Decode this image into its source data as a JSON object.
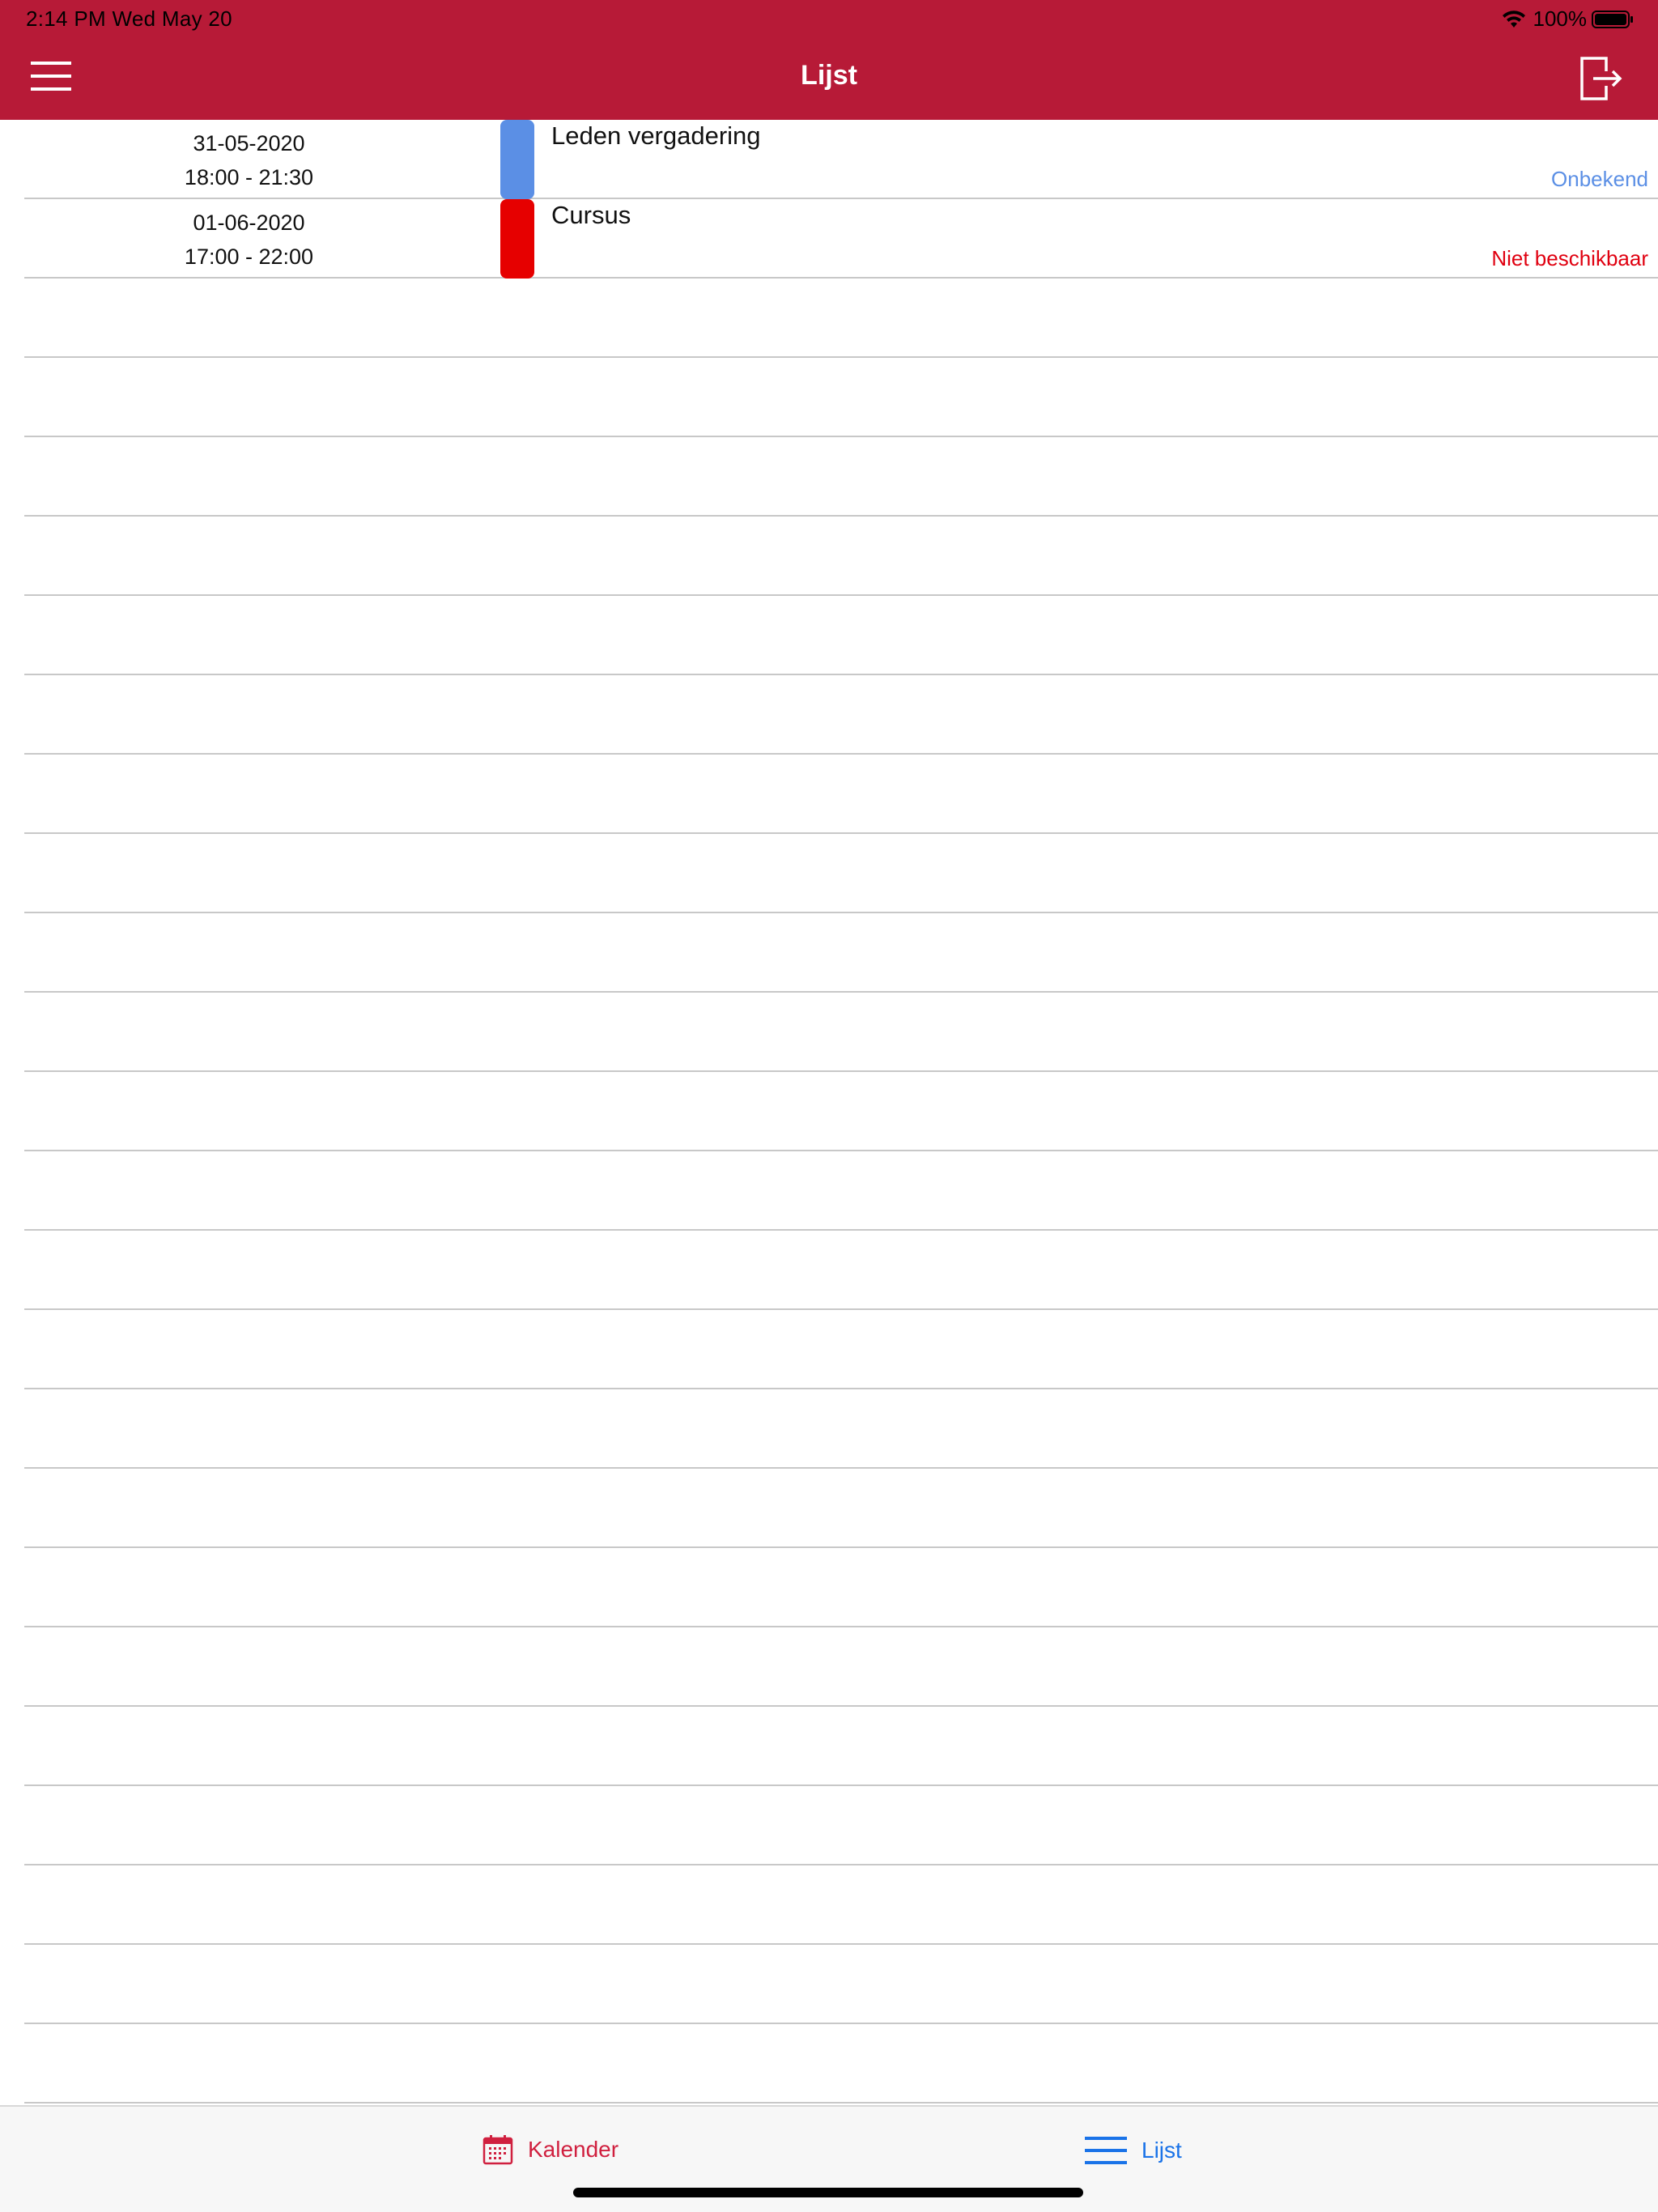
{
  "status_bar": {
    "time_date": "2:14 PM   Wed May 20",
    "battery": "100%"
  },
  "nav": {
    "title": "Lijst",
    "menu_icon": "hamburger-menu-icon",
    "logout_icon": "logout-exit-icon"
  },
  "list": {
    "items": [
      {
        "date": "31-05-2020",
        "time": "18:00 - 21:30",
        "title": "Leden vergadering",
        "status": "Onbekend",
        "marker_color": "#5b8fe5",
        "status_color": "#5b8fe5"
      },
      {
        "date": "01-06-2020",
        "time": "17:00 - 22:00",
        "title": "Cursus",
        "status": "Niet beschikbaar",
        "marker_color": "#e60000",
        "status_color": "#e00010"
      }
    ]
  },
  "tabbar": {
    "calendar_label": "Kalender",
    "calendar_icon": "calendar-icon",
    "calendar_color": "#d0203f",
    "list_label": "Lijst",
    "list_icon": "list-icon",
    "list_color": "#1a73e8"
  },
  "colors": {
    "brand": "#b71a37",
    "divider": "#c8c8c8"
  }
}
